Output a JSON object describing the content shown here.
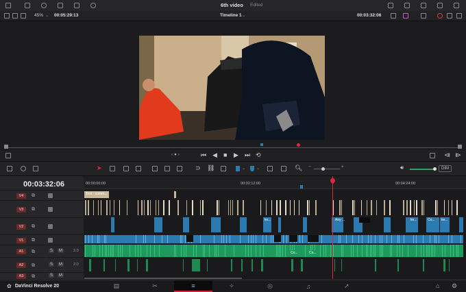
{
  "header": {
    "project_name": "6th video",
    "status": "Edited"
  },
  "viewer_bar": {
    "zoom": "45%",
    "source_timecode": "00:05:29:13",
    "timeline_name": "Timeline 1",
    "record_timecode": "00:03:32:06"
  },
  "timeline": {
    "current_timecode": "00:03:32:06",
    "ruler_marks": [
      "00:00:00:00",
      "00:02:12:00",
      "00:04:24:00"
    ],
    "playhead_fraction": 0.65
  },
  "tracks": [
    {
      "id": "V4",
      "type": "video"
    },
    {
      "id": "V3",
      "type": "video"
    },
    {
      "id": "V2",
      "type": "video"
    },
    {
      "id": "V1",
      "type": "video"
    },
    {
      "id": "A1",
      "type": "audio",
      "level": "2.0"
    },
    {
      "id": "A2",
      "type": "audio",
      "level": "2.0"
    },
    {
      "id": "A3",
      "type": "audio",
      "level": ""
    }
  ],
  "clip_labels": {
    "v4_text": "Text - comm...",
    "v2_a": "ke...",
    "v2_b": "Any ...",
    "v2_c": "Co...",
    "v2_d": "ke...",
    "v2_e": "ke...",
    "a1_a": "Co...",
    "a1_b": "Co..."
  },
  "audio_controls": {
    "solo": "S",
    "mute": "M",
    "dim": "DIM"
  },
  "app": {
    "name": "DaVinci Resolve 20"
  },
  "pages": [
    {
      "name": "media-page",
      "icon": "▤",
      "active": false
    },
    {
      "name": "cut-page",
      "icon": "✂",
      "active": false
    },
    {
      "name": "edit-page",
      "icon": "≡",
      "active": true
    },
    {
      "name": "fusion-page",
      "icon": "✧",
      "active": false
    },
    {
      "name": "color-page",
      "icon": "◎",
      "active": false
    },
    {
      "name": "fairlight-page",
      "icon": "♫",
      "active": false
    },
    {
      "name": "deliver-page",
      "icon": "➚",
      "active": false
    }
  ],
  "colors": {
    "accent_red": "#e0283c",
    "video_clip": "#2b7bb1",
    "audio_clip": "#1f9a5e",
    "text_clip": "#cbb89a"
  }
}
